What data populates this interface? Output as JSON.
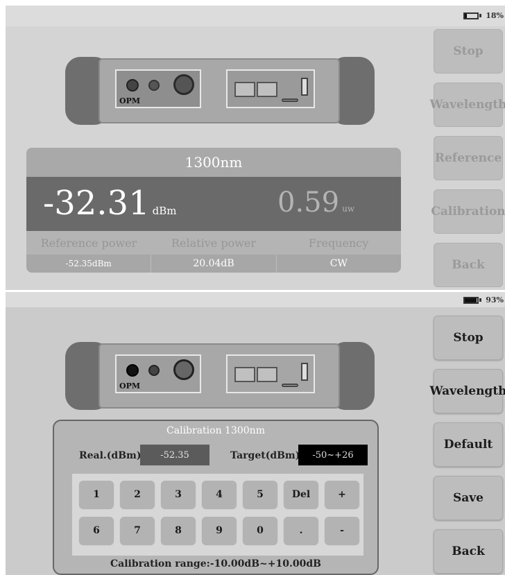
{
  "top_screen": {
    "battery_level": "18%",
    "battery_fraction": 0.18,
    "side_buttons": [
      "Stop",
      "Wavelength",
      "Reference",
      "Calibration",
      "Back"
    ],
    "device_label": "OPM",
    "meter": {
      "wavelength": "1300nm",
      "power_value": "-32.31",
      "power_unit": "dBm",
      "power_uw_value": "0.59",
      "power_uw_unit": "uw",
      "labels": [
        "Reference power",
        "Relative power",
        "Frequency"
      ],
      "values": [
        "-52.35dBm",
        "20.04dB",
        "CW"
      ]
    }
  },
  "bottom_screen": {
    "battery_level": "93%",
    "battery_fraction": 0.93,
    "side_buttons": [
      "Stop",
      "Wavelength",
      "Default",
      "Save",
      "Back"
    ],
    "device_label": "OPM",
    "calibration": {
      "title": "Calibration 1300nm",
      "real_label": "Real.(dBm):",
      "real_value": "-52.35",
      "target_label": "Target(dBm):",
      "target_value": "-50~+26",
      "keys_row1": [
        "1",
        "2",
        "3",
        "4",
        "5",
        "Del",
        "+"
      ],
      "keys_row2": [
        "6",
        "7",
        "8",
        "9",
        "0",
        ".",
        "-"
      ],
      "range_text": "Calibration range:-10.00dB~+10.00dB"
    }
  },
  "colors": {
    "real_field_bg": "#5b5b5b",
    "target_field_bg": "#000000"
  }
}
